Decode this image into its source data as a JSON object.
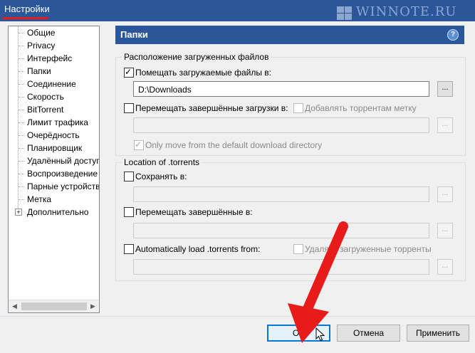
{
  "window": {
    "title": "Настройки"
  },
  "watermark": {
    "text": "WINNOTE.RU"
  },
  "tree": {
    "items": [
      "Общие",
      "Privacy",
      "Интерфейс",
      "Папки",
      "Соединение",
      "Скорость",
      "BitTorrent",
      "Лимит трафика",
      "Очерёдность",
      "Планировщик",
      "Удалённый доступ",
      "Воспроизведение",
      "Парные устройства",
      "Метка",
      "Дополнительно"
    ],
    "selected": "Папки",
    "expandable_item": "Дополнительно"
  },
  "panel": {
    "title": "Папки",
    "help_icon": "?"
  },
  "downloads": {
    "group_title": "Расположение загруженных файлов",
    "put_new_label": "Помещать загружаемые файлы в:",
    "put_new_checked": true,
    "put_new_path": "D:\\Downloads",
    "move_completed_label": "Перемещать завершённые загрузки в:",
    "move_completed_checked": false,
    "add_label_label": "Добавлять торрентам метку",
    "add_label_checked": false,
    "move_completed_path": "",
    "only_move_default_label": "Only move from the default download directory",
    "only_move_default_checked": true
  },
  "torrents": {
    "group_title": "Location of .torrents",
    "store_label": "Сохранять в:",
    "store_checked": false,
    "store_path": "",
    "move_completed_label": "Перемещать завершённые в:",
    "move_completed_checked": false,
    "move_completed_path": "",
    "autoload_label": "Automatically load .torrents from:",
    "autoload_checked": false,
    "delete_loaded_label": "Удалять загруженные торренты",
    "delete_loaded_checked": false,
    "autoload_path": ""
  },
  "browse_label": "...",
  "buttons": {
    "ok": "OK",
    "cancel": "Отмена",
    "apply": "Применить"
  },
  "colors": {
    "title_bar": "#2b579a",
    "accent_arrow": "#e81b1b",
    "panel_header": "#2b579a"
  }
}
